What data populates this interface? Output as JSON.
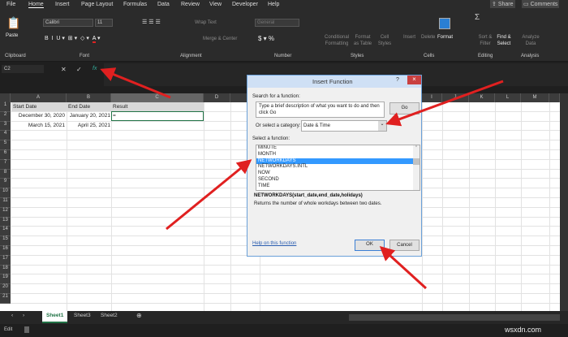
{
  "menu": [
    "File",
    "Home",
    "Insert",
    "Page Layout",
    "Formulas",
    "Data",
    "Review",
    "View",
    "Developer",
    "Help"
  ],
  "share": "Share",
  "comments": "Comments",
  "ribbon": {
    "paste": "Paste",
    "font_name": "Calibri",
    "font_size": "11",
    "wrap": "Wrap Text",
    "merge": "Merge & Center",
    "number_format": "General",
    "cond": "Conditional Formatting",
    "fmt_table": "Format as Table",
    "cell_styles": "Cell Styles",
    "insert": "Insert",
    "delete": "Delete",
    "format": "Format",
    "sort": "Sort & Filter",
    "find": "Find & Select",
    "analyze": "Analyze Data",
    "groups": [
      "Clipboard",
      "Font",
      "Alignment",
      "Number",
      "Styles",
      "Cells",
      "Editing",
      "Analysis"
    ]
  },
  "formula_bar": {
    "name_box": "C2",
    "fx": "fx"
  },
  "columns": [
    "A",
    "B",
    "C",
    "D",
    "E",
    "I",
    "J",
    "K",
    "L",
    "M"
  ],
  "rows": [
    "1",
    "2",
    "3",
    "4",
    "5",
    "6",
    "7",
    "8",
    "9",
    "10",
    "11",
    "12",
    "13",
    "14",
    "15",
    "16",
    "17",
    "18",
    "19",
    "20",
    "21"
  ],
  "cells": {
    "a1": "Start Date",
    "b1": "End Date",
    "c1": "Result",
    "a2": "December 30, 2020",
    "b2": "January 20, 2021",
    "c2": "=",
    "a3": "March 15, 2021",
    "b3": "April 25, 2021"
  },
  "dialog": {
    "title": "Insert Function",
    "help": "?",
    "close": "×",
    "search_label": "Search for a function:",
    "search_value": "Type a brief description of what you want to do and then click Go",
    "go": "Go",
    "category_label": "Or select a category:",
    "category": "Date & Time",
    "select_label": "Select a function:",
    "functions": [
      "MINUTE",
      "MONTH",
      "NETWORKDAYS",
      "NETWORKDAYS.INTL",
      "NOW",
      "SECOND",
      "TIME"
    ],
    "signature": "NETWORKDAYS(start_date,end_date,holidays)",
    "description": "Returns the number of whole workdays between two dates.",
    "help_link": "Help on this function",
    "ok": "OK",
    "cancel": "Cancel"
  },
  "sheets": [
    "Sheet1",
    "Sheet3",
    "Sheet2"
  ],
  "status": "Edit",
  "watermark": "wsxdn.com",
  "colors": {
    "accent": "#217346",
    "arrow": "#e02020",
    "selection": "#3399ff"
  }
}
